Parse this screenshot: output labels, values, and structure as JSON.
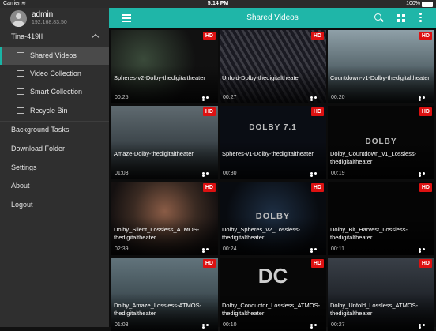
{
  "status": {
    "carrier": "Carrier",
    "wifi_icon": "wifi-icon",
    "time": "5:14 PM",
    "battery": "100%"
  },
  "user": {
    "name": "admin",
    "ip": "192.168.83.50"
  },
  "sidebar": {
    "device": "Tina-419II",
    "items": [
      {
        "label": "Shared Videos",
        "icon": "shared-videos-icon"
      },
      {
        "label": "Video Collection",
        "icon": "video-collection-icon"
      },
      {
        "label": "Smart Collection",
        "icon": "smart-collection-icon"
      },
      {
        "label": "Recycle Bin",
        "icon": "trash-icon"
      }
    ],
    "menu": [
      "Background Tasks",
      "Download Folder",
      "Settings",
      "About",
      "Logout"
    ]
  },
  "header": {
    "title": "Shared Videos"
  },
  "badge": "HD",
  "more_label": "•••",
  "logos": {
    "dolby": "DOLBY",
    "dolby71": "DOLBY 7.1",
    "dc": "DC"
  },
  "videos": [
    {
      "title": "Spheres-v2-Dolby-thedigitaltheater",
      "duration": "00:25"
    },
    {
      "title": "Unfold-Dolby-thedigitaltheater",
      "duration": "00:27"
    },
    {
      "title": "Countdown-v1-Dolby-thedigitaltheater",
      "duration": "00:20"
    },
    {
      "title": "Amaze-Dolby-thedigitaltheater",
      "duration": "01:03"
    },
    {
      "title": "Spheres-v1-Dolby-thedigitaltheater",
      "duration": "00:30"
    },
    {
      "title": "Dolby_Countdown_v1_Lossless-thedigitaltheater",
      "duration": "00:19"
    },
    {
      "title": "Dolby_Silent_Lossless_ATMOS-thedigitaltheater",
      "duration": "02:39"
    },
    {
      "title": "Dolby_Spheres_v2_Lossless-thedigitaltheater",
      "duration": "00:24"
    },
    {
      "title": "Dolby_Bit_Harvest_Lossless-thedigitaltheater",
      "duration": "00:11"
    },
    {
      "title": "Dolby_Amaze_Lossless-ATMOS-thedigitaltheater",
      "duration": "01:03"
    },
    {
      "title": "Dolby_Conductor_Lossless_ATMOS-thedigitaltheater",
      "duration": "00:10"
    },
    {
      "title": "Dolby_Unfold_Lossless_ATMOS-thedigitaltheater",
      "duration": "00:27"
    }
  ],
  "colors": {
    "accent": "#1fb6a8",
    "sidebar": "#2f2f2f",
    "hd_badge": "#dd1111"
  }
}
